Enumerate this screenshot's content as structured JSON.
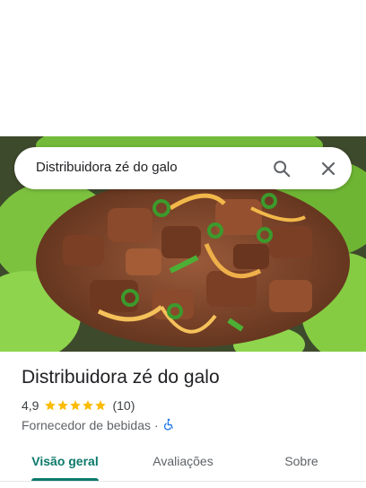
{
  "search": {
    "query": "Distribuidora zé do galo"
  },
  "icons": {
    "search": "search-icon",
    "close": "close-icon",
    "accessibility": "wheelchair-icon"
  },
  "place": {
    "name": "Distribuidora zé do galo",
    "rating": "4,9",
    "stars": 5,
    "review_count": "(10)",
    "category": "Fornecedor de bebidas",
    "separator": "·"
  },
  "tabs": [
    {
      "label": "Visão geral",
      "active": true
    },
    {
      "label": "Avaliações",
      "active": false
    },
    {
      "label": "Sobre",
      "active": false
    }
  ],
  "colors": {
    "accent": "#0b7a6b",
    "star": "#fbbc04",
    "accessibility": "#1a73e8"
  }
}
